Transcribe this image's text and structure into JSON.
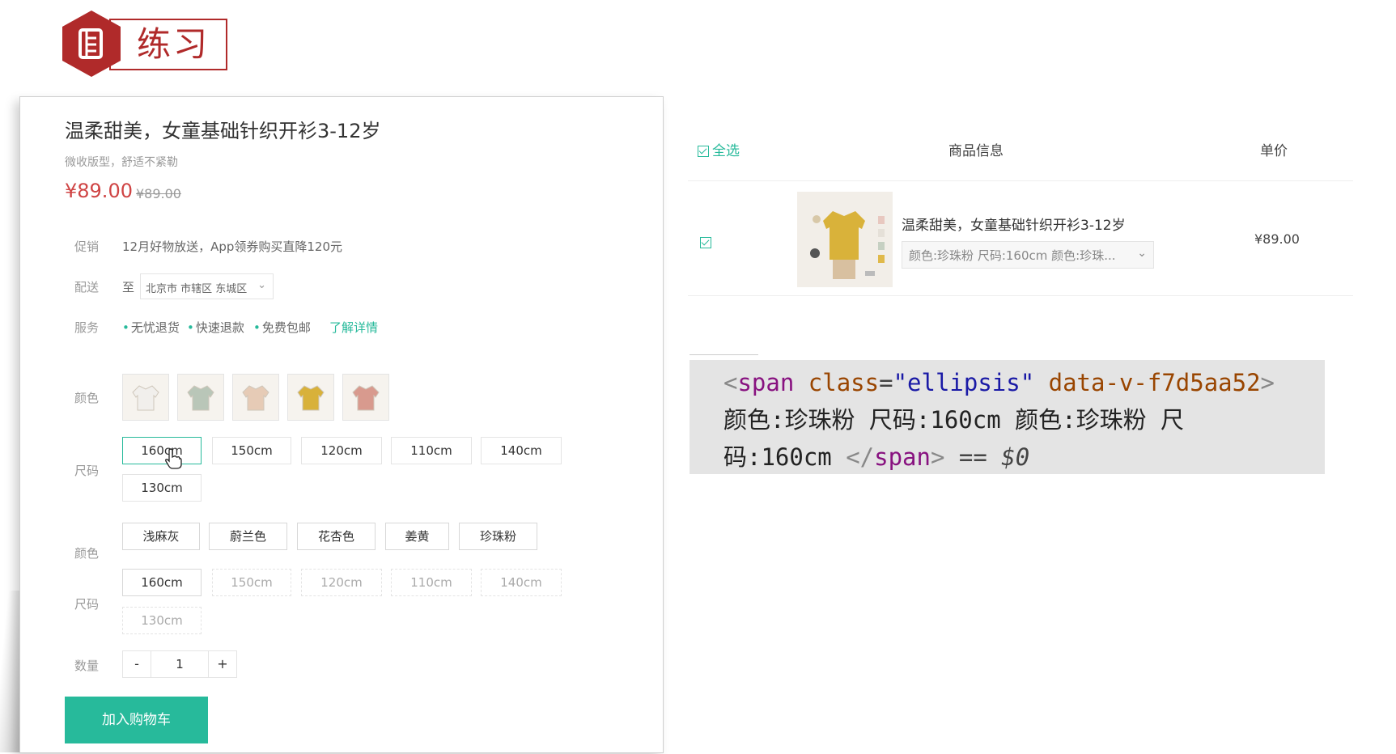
{
  "slide": {
    "badge_text": "练习"
  },
  "product": {
    "title": "温柔甜美，女童基础针织开衫3-12岁",
    "subtitle": "微收版型，舒适不紧勒",
    "price": "¥89.00",
    "old_price": "¥89.00",
    "promo": {
      "label": "促销",
      "text": "12月好物放送，App领券购买直降120元"
    },
    "delivery": {
      "label": "配送",
      "to": "至",
      "address": "北京市 市辖区 东城区"
    },
    "service": {
      "label": "服务",
      "items": [
        "无忧退货",
        "快速退款",
        "免费包邮"
      ],
      "link": "了解详情"
    },
    "spec1": {
      "color_label": "颜色",
      "swatch_colors": [
        "#f1efec",
        "#b9c6b8",
        "#e6cbb6",
        "#d8b13a",
        "#d89a8e"
      ],
      "size_label": "尺码",
      "sizes": [
        "160cm",
        "150cm",
        "120cm",
        "110cm",
        "140cm",
        "130cm"
      ]
    },
    "spec2": {
      "color_label": "颜色",
      "colors": [
        "浅麻灰",
        "蔚兰色",
        "花杏色",
        "姜黄",
        "珍珠粉"
      ],
      "size_label": "尺码",
      "sizes": [
        "160cm",
        "150cm",
        "120cm",
        "110cm",
        "140cm",
        "130cm"
      ]
    },
    "quantity": {
      "label": "数量",
      "minus": "-",
      "value": "1",
      "plus": "+"
    },
    "add_to_cart": "加入购物车"
  },
  "cart": {
    "header": {
      "select_all": "全选",
      "info": "商品信息",
      "price": "单价"
    },
    "item": {
      "name": "温柔甜美，女童基础针织开衫3-12岁",
      "sku": "颜色:珍珠粉 尺码:160cm 颜色:珍珠...",
      "price": "¥89.00"
    }
  },
  "code": {
    "open_lt": "<",
    "tag": "span",
    "attr": "class",
    "eq": "=",
    "val": "\"ellipsis\"",
    "attr2": "data-v-f7d5aa52",
    "open_gt": ">",
    "text1": "颜色:珍珠粉 尺码:160cm 颜色:珍珠粉 尺",
    "text2": "码:160cm ",
    "close_lt": "</",
    "close_gt": ">",
    "tail": "== $0"
  },
  "colors": {
    "accent": "#27ba9b",
    "price_red": "#cf4444",
    "badge_red": "#b02a2a"
  }
}
